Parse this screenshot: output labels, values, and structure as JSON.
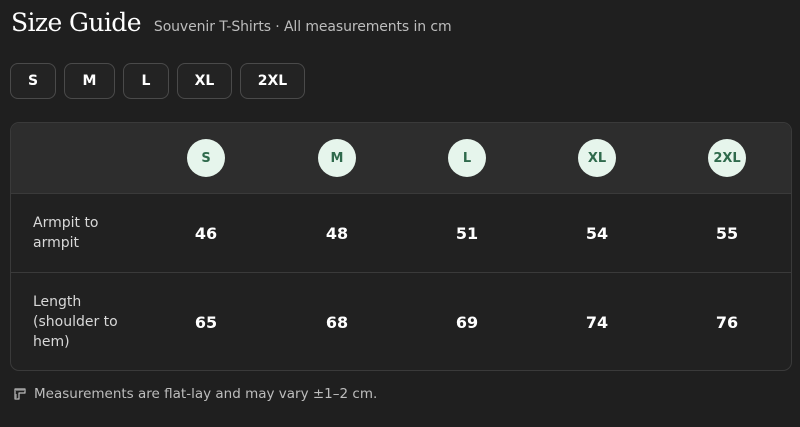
{
  "header": {
    "title": "Size Guide",
    "subtitle": "Souvenir T-Shirts · All measurements in cm"
  },
  "size_buttons": [
    "S",
    "M",
    "L",
    "XL",
    "2XL"
  ],
  "table": {
    "sizes": [
      "S",
      "M",
      "L",
      "XL",
      "2XL"
    ],
    "rows": [
      {
        "label": "Armpit to armpit",
        "values": [
          "46",
          "48",
          "51",
          "54",
          "55"
        ]
      },
      {
        "label": "Length (shoulder to hem)",
        "values": [
          "65",
          "68",
          "69",
          "74",
          "76"
        ]
      }
    ]
  },
  "footer": {
    "icon": "ruler-icon",
    "note": "Measurements are flat-lay and may vary ±1–2 cm."
  },
  "colors": {
    "background": "#1f1f1f",
    "pill_bg": "#e6f5ec",
    "pill_text": "#2f6a4c"
  }
}
